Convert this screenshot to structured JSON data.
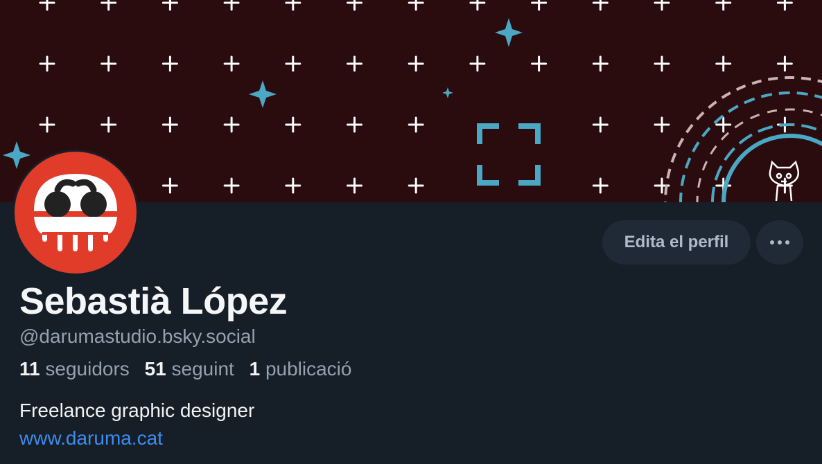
{
  "profile": {
    "display_name": "Sebastià López",
    "handle": "@darumastudio.bsky.social",
    "bio": "Freelance graphic designer",
    "website": "www.daruma.cat",
    "stats": {
      "followers_count": "11",
      "followers_label": "seguidors",
      "following_count": "51",
      "following_label": "seguint",
      "posts_count": "1",
      "posts_label": "publicació"
    }
  },
  "actions": {
    "edit_label": "Edita el perfil",
    "more_icon": "ellipsis-icon"
  },
  "colors": {
    "background": "#161e27",
    "banner": "#2a0c0e",
    "accent_teal": "#4aa8c4",
    "avatar_red": "#e13b2a",
    "link_blue": "#3d8cf0",
    "button_bg": "#1f2a36"
  }
}
